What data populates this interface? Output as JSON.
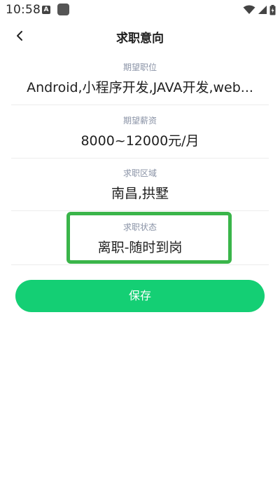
{
  "status_bar": {
    "time": "10:58",
    "notification_icon": "a-letter-icon",
    "app_icon": "square-app-icon",
    "wifi_icon": "wifi-icon",
    "signal_icon": "signal-icon",
    "battery_icon": "battery-charging-icon"
  },
  "header": {
    "back_icon": "chevron-left-icon",
    "title": "求职意向"
  },
  "fields": [
    {
      "label": "期望职位",
      "value": "Android,小程序开发,JAVA开发,web..."
    },
    {
      "label": "期望薪资",
      "value": "8000~12000元/月"
    },
    {
      "label": "求职区域",
      "value": "南昌,拱墅"
    },
    {
      "label": "求职状态",
      "value": "离职-随时到岗"
    }
  ],
  "save_button": {
    "label": "保存"
  },
  "colors": {
    "accent": "#14cf74",
    "highlight_border": "#3ab54a",
    "label": "#8a93a6"
  }
}
